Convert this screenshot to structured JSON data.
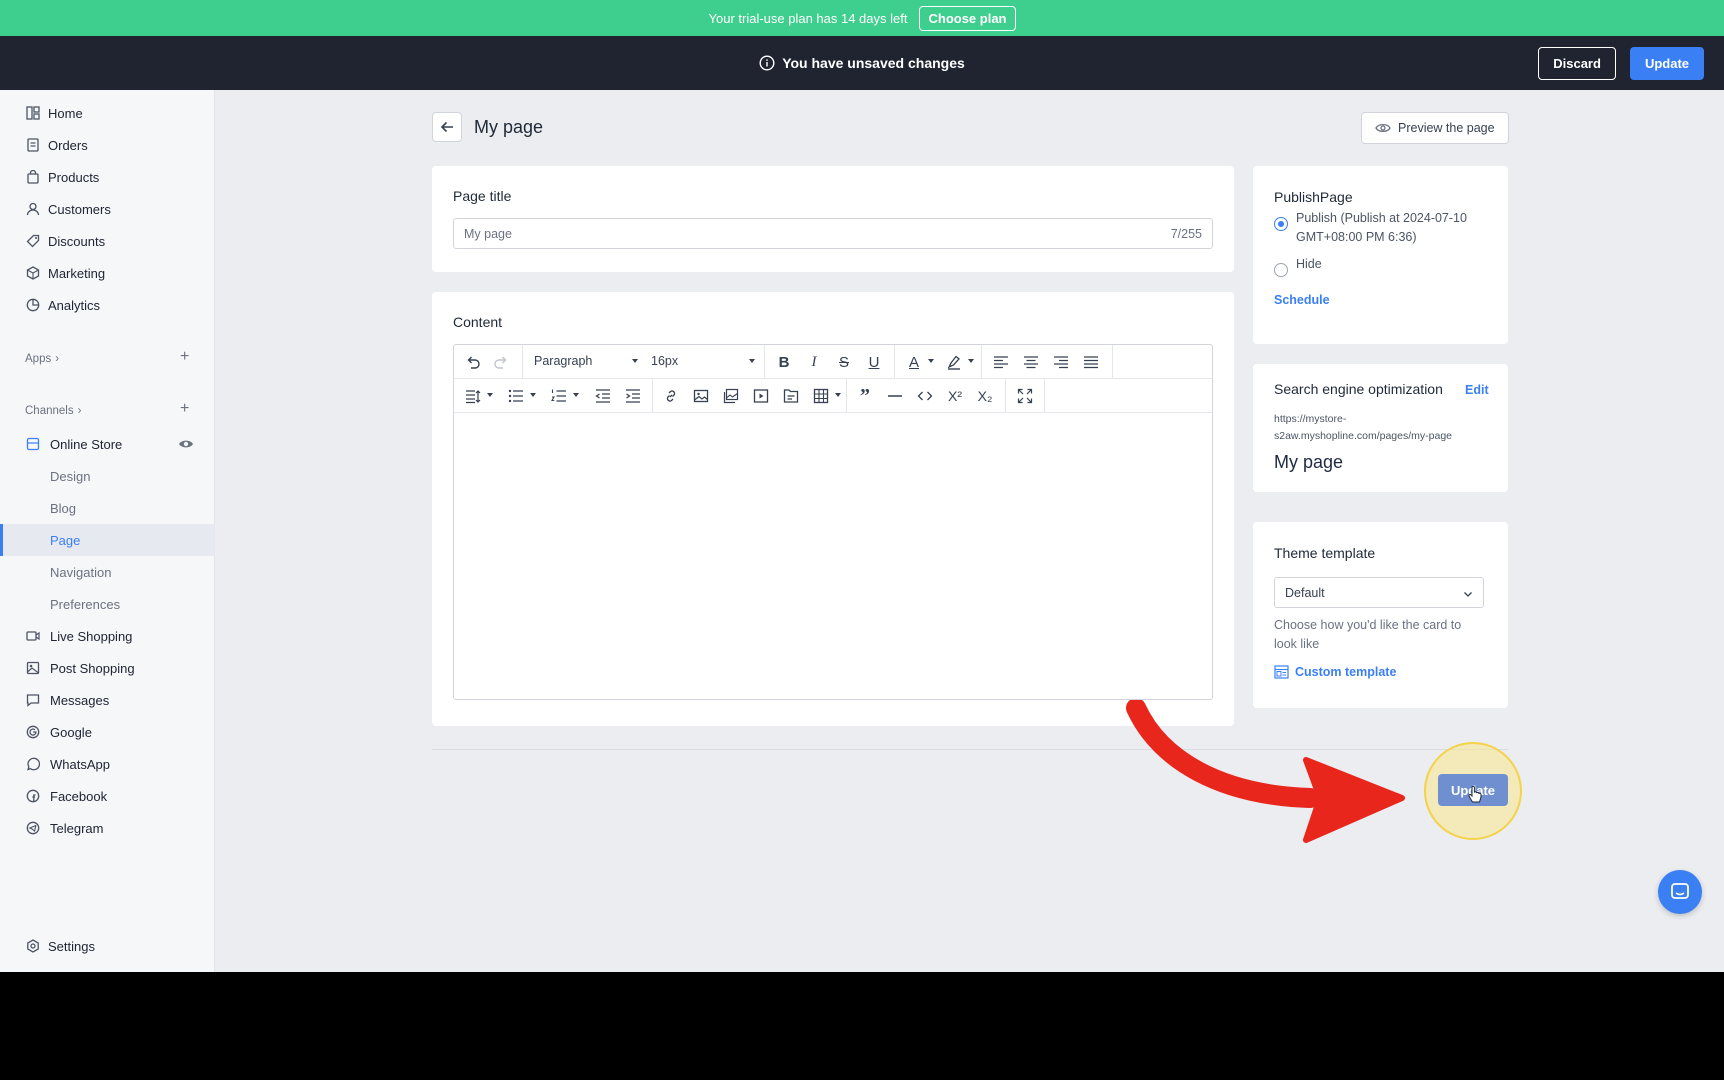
{
  "trial_bar": {
    "message": "Your trial-use plan has 14 days left",
    "choose_label": "Choose plan"
  },
  "unsaved_bar": {
    "message": "You have unsaved changes",
    "discard_label": "Discard",
    "update_label": "Update"
  },
  "sidebar": {
    "items": [
      {
        "label": "Home",
        "icon": "home-icon"
      },
      {
        "label": "Orders",
        "icon": "orders-icon"
      },
      {
        "label": "Products",
        "icon": "bag-icon"
      },
      {
        "label": "Customers",
        "icon": "user-icon"
      },
      {
        "label": "Discounts",
        "icon": "tag-icon"
      },
      {
        "label": "Marketing",
        "icon": "marketing-icon"
      },
      {
        "label": "Analytics",
        "icon": "chart-icon"
      }
    ],
    "apps_label": "Apps",
    "channels_label": "Channels",
    "online_store_label": "Online Store",
    "store_subitems": [
      "Design",
      "Blog",
      "Page",
      "Navigation",
      "Preferences"
    ],
    "channel_items": [
      {
        "label": "Live Shopping",
        "icon": "video-icon"
      },
      {
        "label": "Post Shopping",
        "icon": "post-icon"
      },
      {
        "label": "Messages",
        "icon": "message-icon"
      },
      {
        "label": "Google",
        "icon": "google-icon"
      },
      {
        "label": "WhatsApp",
        "icon": "whatsapp-icon"
      },
      {
        "label": "Facebook",
        "icon": "facebook-icon"
      },
      {
        "label": "Telegram",
        "icon": "telegram-icon"
      }
    ],
    "settings_label": "Settings"
  },
  "header": {
    "title": "My page",
    "preview_label": "Preview the page"
  },
  "title_card": {
    "label": "Page title",
    "value": "My page",
    "counter": "7/255"
  },
  "content_card": {
    "label": "Content",
    "block_format": "Paragraph",
    "font_size": "16px"
  },
  "publish_card": {
    "title": "PublishPage",
    "publish_label": "Publish",
    "publish_detail_line1": "(Publish at 2024-07-10",
    "publish_detail_line2": "GMT+08:00 PM 6:36)",
    "hide_label": "Hide",
    "schedule_label": "Schedule"
  },
  "seo_card": {
    "title": "Search engine optimization",
    "edit_label": "Edit",
    "url_line1": "https://mystore-",
    "url_line2": "s2aw.myshopline.com/pages/my-page",
    "page_name": "My page"
  },
  "theme_card": {
    "title": "Theme template",
    "selected": "Default",
    "help_line1": "Choose how you'd like the card to",
    "help_line2": "look like",
    "custom_label": "Custom template"
  },
  "footer": {
    "update_label": "Update"
  },
  "colors": {
    "accent": "#3b7ff5",
    "trial_green": "#3ecf8e",
    "dark_bar": "#1f2430",
    "arrow_red": "#e8261c"
  }
}
